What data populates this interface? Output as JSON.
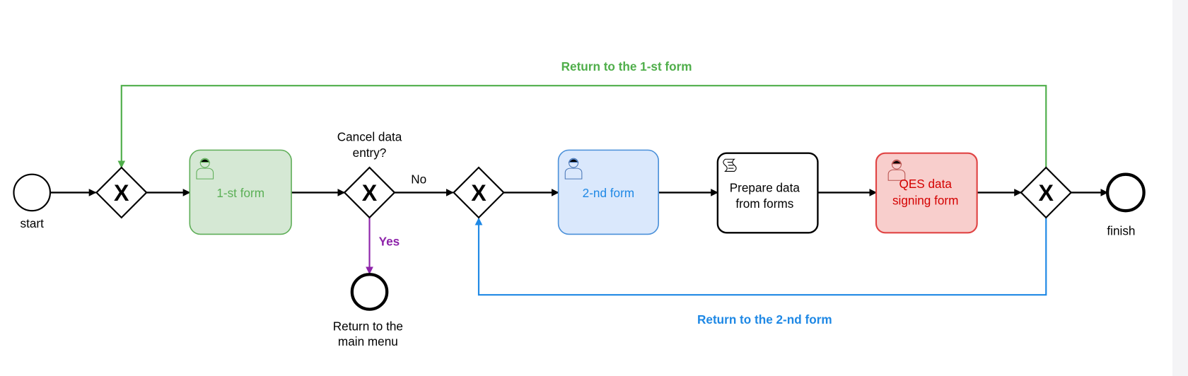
{
  "diagram": {
    "events": {
      "start": "start",
      "finish": "finish",
      "main_menu": [
        "Return to the",
        "main menu"
      ]
    },
    "gateway_marker": "X",
    "gateway_question": [
      "Cancel data",
      "entry?"
    ],
    "tasks": {
      "form1": {
        "label": "1-st form",
        "icon": "user-icon"
      },
      "form2": {
        "label": "2-nd form",
        "icon": "user-icon"
      },
      "prepare": {
        "label": [
          "Prepare data",
          "from forms"
        ],
        "icon": "script-icon"
      },
      "qes": {
        "label": [
          "QES data",
          "signing form"
        ],
        "icon": "user-icon"
      }
    },
    "flow_labels": {
      "no": "No",
      "yes": "Yes",
      "return_first": "Return to the 1-st form",
      "return_second": "Return to the 2-nd form"
    },
    "colors": {
      "green": "#4fae4a",
      "green_fill": "#d5e8d4",
      "blue": "#1e88e5",
      "blue_fill": "#dae8fc",
      "red": "#d40000",
      "red_fill": "#f8cecc",
      "purple": "#8e24aa"
    }
  }
}
